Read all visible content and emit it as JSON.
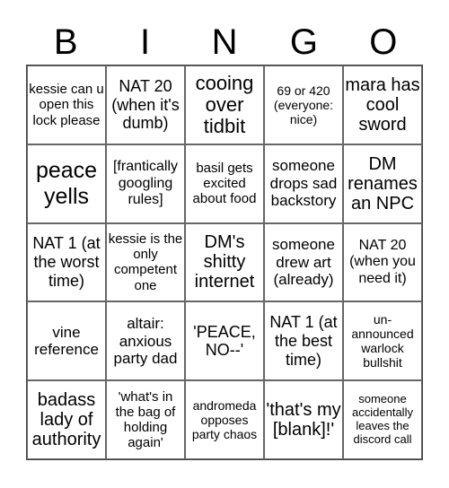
{
  "header": {
    "letters": [
      "B",
      "I",
      "N",
      "G",
      "O"
    ]
  },
  "cells": [
    "kessie can u open this lock please",
    "NAT 20 (when it's dumb)",
    "cooing over tidbit",
    "69 or 420 (everyone: nice)",
    "mara has cool sword",
    "peace yells",
    "[frantically googling rules]",
    "basil gets excited about food",
    "someone drops sad backstory",
    "DM renames an NPC",
    "NAT 1 (at the worst time)",
    "kessie is the only competent one",
    "DM's shitty internet",
    "someone drew art (already)",
    "NAT 20 (when you need it)",
    "vine reference",
    "altair: anxious party dad",
    "'PEACE, NO--'",
    "NAT 1 (at the best time)",
    "un-announced warlock bullshit",
    "badass lady of authority",
    "'what's in the bag of holding again'",
    "andromeda opposes party chaos",
    "'that's my [blank]!'",
    "someone accidentally leaves the discord call"
  ]
}
